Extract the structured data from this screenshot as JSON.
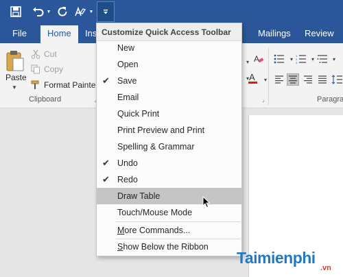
{
  "qat": {
    "icons": [
      "save-icon",
      "undo-icon",
      "redo-icon",
      "touch-mode-icon",
      "customize-qat-icon"
    ]
  },
  "tabs": [
    {
      "label": "File"
    },
    {
      "label": "Home",
      "active": true
    },
    {
      "label": "Ins"
    },
    {
      "label": "Mailings"
    },
    {
      "label": "Review"
    }
  ],
  "ribbon": {
    "paste_label": "Paste",
    "cut_label": "Cut",
    "copy_label": "Copy",
    "format_painter_label": "Format Painter",
    "clipboard_group": "Clipboard",
    "paragraph_group": "Paragra"
  },
  "menu": {
    "title": "Customize Quick Access Toolbar",
    "items": [
      {
        "label": "New",
        "checked": false
      },
      {
        "label": "Open",
        "checked": false
      },
      {
        "label": "Save",
        "checked": true
      },
      {
        "label": "Email",
        "checked": false
      },
      {
        "label": "Quick Print",
        "checked": false
      },
      {
        "label": "Print Preview and Print",
        "checked": false
      },
      {
        "label": "Spelling & Grammar",
        "checked": false
      },
      {
        "label": "Undo",
        "checked": true
      },
      {
        "label": "Redo",
        "checked": true
      },
      {
        "label": "Draw Table",
        "checked": false,
        "hover": true
      },
      {
        "label": "Touch/Mouse Mode",
        "checked": false
      }
    ],
    "more_commands": {
      "first": "M",
      "rest": "ore Commands..."
    },
    "show_below": {
      "first": "S",
      "rest": "how Below the Ribbon"
    },
    "check_glyph": "✔"
  },
  "watermark": {
    "name": "Taimienphi",
    "suffix": ".vn"
  },
  "colors": {
    "accent": "#2b579a",
    "ribbon_bg": "#f3f3f3",
    "hover": "#c5c5c5",
    "font_color_red": "#e81123"
  }
}
